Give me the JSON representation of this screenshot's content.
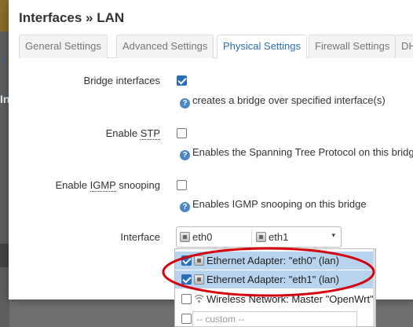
{
  "backdrop": {
    "letter1": "I",
    "link": "I",
    "letter2": "In"
  },
  "modal": {
    "title": "Interfaces » LAN",
    "tabs": [
      {
        "label": "General Settings",
        "active": false
      },
      {
        "label": "Advanced Settings",
        "active": false
      },
      {
        "label": "Physical Settings",
        "active": true
      },
      {
        "label": "Firewall Settings",
        "active": false
      },
      {
        "label": "DHC",
        "active": false
      }
    ]
  },
  "form": {
    "bridge": {
      "label": "Bridge interfaces",
      "checked": true,
      "hint": "creates a bridge over specified interface(s)"
    },
    "stp": {
      "label_prefix": "Enable ",
      "label_abbr": "STP",
      "checked": false,
      "hint": "Enables the Spanning Tree Protocol on this bridge"
    },
    "igmp": {
      "label_prefix": "Enable ",
      "label_abbr": "IGMP",
      "label_suffix": " snooping",
      "checked": false,
      "hint": "Enables IGMP snooping on this bridge"
    },
    "interface": {
      "label": "Interface",
      "selected": [
        "eth0",
        "eth1"
      ],
      "options": [
        {
          "label": "Ethernet Adapter: \"eth0\" (lan)",
          "checked": true,
          "icon": "ethernet-icon"
        },
        {
          "label": "Ethernet Adapter: \"eth1\" (lan)",
          "checked": true,
          "icon": "ethernet-icon"
        },
        {
          "label": "Wireless Network: Master \"OpenWrt\"",
          "checked": false,
          "icon": "wifi-icon"
        }
      ],
      "custom_placeholder": "-- custom --"
    }
  },
  "colors": {
    "accent": "#2a6ebb",
    "annotation": "#d4000f",
    "selected_row": "#b8d3ee"
  }
}
